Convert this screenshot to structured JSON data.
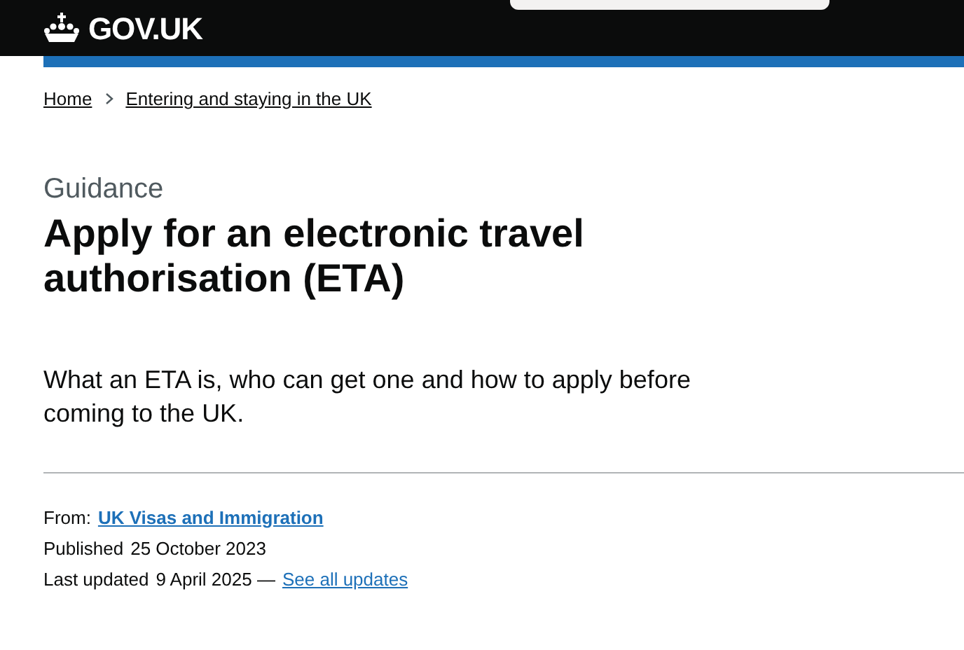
{
  "header": {
    "logo": "GOV.UK"
  },
  "breadcrumbs": [
    {
      "label": "Home"
    },
    {
      "label": "Entering and staying in the UK"
    }
  ],
  "caption": "Guidance",
  "title": "Apply for an electronic travel authorisation (ETA)",
  "lead": "What an ETA is, who can get one and how to apply before coming to the UK.",
  "metadata": {
    "from_label": "From:",
    "from_link": "UK Visas and Immigration",
    "published_label": "Published",
    "published_date": "25 October 2023",
    "updated_label": "Last updated",
    "updated_date": "9 April 2025 —",
    "updates_link": "See all updates"
  }
}
